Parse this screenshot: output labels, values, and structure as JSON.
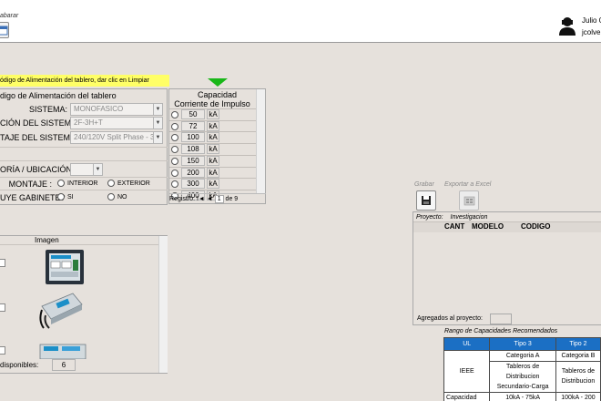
{
  "header": {
    "top_button_label": "abarar",
    "user_name": "Julio O",
    "user_email": "jcolver"
  },
  "hint": "ódigo de Alimentación del tablero, dar clic en Limpiar",
  "form": {
    "title": "digo de Alimentación del tablero",
    "sistema_label": "SISTEMA:",
    "sistema_value": "MONOFASICO",
    "conexion_label": "CIÓN DEL SISTEMA:",
    "conexion_value": "2F-3H+T",
    "voltaje_label": "TAJE DEL SISTEMA:",
    "voltaje_value": "240/120V Split Phase - 3",
    "categoria_label": "ORÍA / UBICACIÓN:",
    "categoria_value": "",
    "montaje_label": "MONTAJE :",
    "montaje_options": [
      "INTERIOR",
      "EXTERIOR"
    ],
    "gabinete_label": "UYE GABINETE?",
    "gabinete_options": [
      "SI",
      "NO"
    ]
  },
  "capacidad": {
    "title": "Capacidad",
    "subtitle": "Corriente de Impulso",
    "unit": "kA",
    "values": [
      "50",
      "72",
      "100",
      "108",
      "150",
      "200",
      "300",
      "400"
    ],
    "pager_label": "Registro:",
    "pager_first": "I◄",
    "pager_prev": "◄",
    "pager_page": "1",
    "pager_of": "de 9"
  },
  "imagen": {
    "title": "Imagen",
    "footer_label": "disponibles:",
    "footer_value": "6"
  },
  "actions": {
    "grabar": "Grabar",
    "exportar": "Exportar a Excel"
  },
  "proyecto": {
    "label": "Proyecto:",
    "name": "Investigacion",
    "columns": [
      "CANT",
      "MODELO",
      "CODIGO"
    ],
    "agregados_label": "Agregados al proyecto:",
    "agregados_value": ""
  },
  "rango": {
    "title": "Rango de Capacidades Recomendados",
    "header": [
      "UL",
      "Tipo 3",
      "Tipo 2"
    ],
    "categoria": [
      "Categoria A",
      "Categoria B"
    ],
    "ieee_label": "IEEE",
    "tableros_a": [
      "Tableros de",
      "Distribucion",
      "Secundario-Carga"
    ],
    "tableros_b": [
      "Tableros de",
      "Distribucion"
    ],
    "capacidad_label": "Capacidad",
    "capacidad_a": "10kA - 75kA",
    "capacidad_b": "100kA - 200"
  },
  "colors": {
    "hint_bg": "#ffff66",
    "arrow": "#19b719",
    "table_header": "#1b6fc4",
    "bg": "#e6e1dc"
  },
  "icons": [
    "user-icon",
    "calendar-icon",
    "save-icon",
    "excel-icon",
    "down-arrow-icon",
    "surge-device-image"
  ]
}
